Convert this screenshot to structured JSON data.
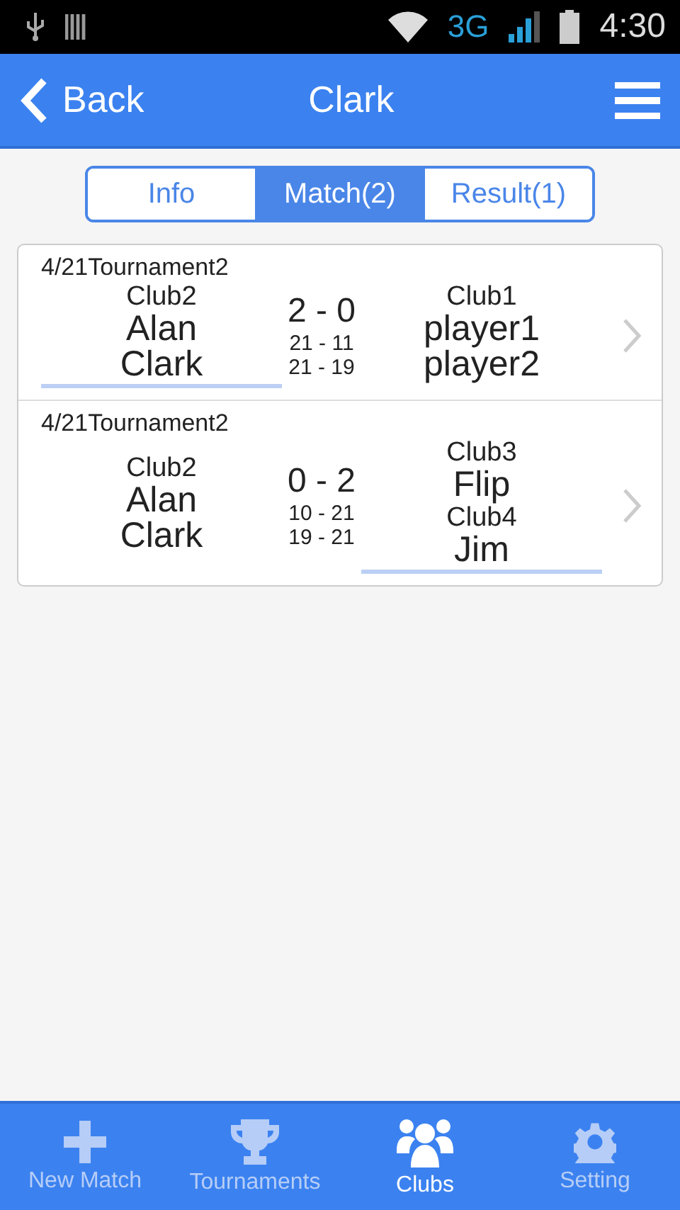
{
  "status_bar": {
    "network": "3G",
    "time": "4:30"
  },
  "app_bar": {
    "back": "Back",
    "title": "Clark"
  },
  "tabs": [
    {
      "label": "Info",
      "selected": false
    },
    {
      "label": "Match(2)",
      "selected": true
    },
    {
      "label": "Result(1)",
      "selected": false
    }
  ],
  "matches": [
    {
      "header": "4/21Tournament2",
      "score": "2 - 0",
      "games": [
        "21 - 11",
        "21 - 19"
      ],
      "left": {
        "winner": true,
        "lines": [
          {
            "kind": "club",
            "text": "Club2"
          },
          {
            "kind": "player",
            "text": "Alan"
          },
          {
            "kind": "player",
            "text": "Clark"
          }
        ]
      },
      "right": {
        "winner": false,
        "lines": [
          {
            "kind": "club",
            "text": "Club1"
          },
          {
            "kind": "player",
            "text": "player1"
          },
          {
            "kind": "player",
            "text": "player2"
          }
        ]
      }
    },
    {
      "header": "4/21Tournament2",
      "score": "0 - 2",
      "games": [
        "10 - 21",
        "19 - 21"
      ],
      "left": {
        "winner": false,
        "lines": [
          {
            "kind": "club",
            "text": "Club2"
          },
          {
            "kind": "player",
            "text": "Alan"
          },
          {
            "kind": "player",
            "text": "Clark"
          }
        ]
      },
      "right": {
        "winner": true,
        "lines": [
          {
            "kind": "club",
            "text": "Club3"
          },
          {
            "kind": "player",
            "text": "Flip"
          },
          {
            "kind": "club",
            "text": "Club4"
          },
          {
            "kind": "player",
            "text": "Jim"
          }
        ]
      }
    }
  ],
  "nav": [
    {
      "kind": "new",
      "label": "New Match",
      "selected": false
    },
    {
      "kind": "trophy",
      "label": "Tournaments",
      "selected": false
    },
    {
      "kind": "clubs",
      "label": "Clubs",
      "selected": true
    },
    {
      "kind": "gear",
      "label": "Setting",
      "selected": false
    }
  ]
}
